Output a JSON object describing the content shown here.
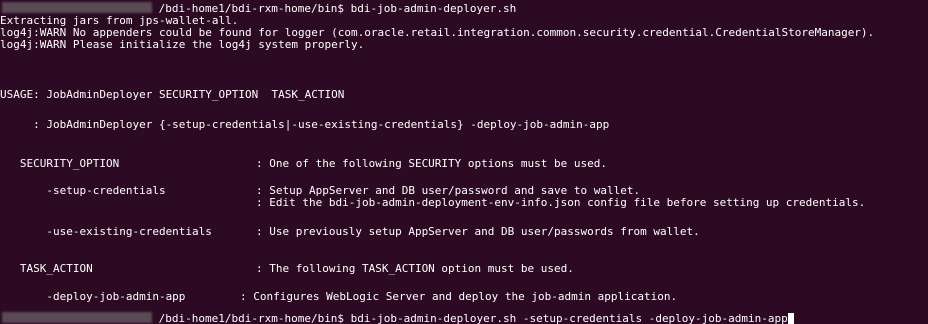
{
  "terminal": {
    "prompt1_suffix": "/bdi-home1/bdi-rxm-home/bin$ bdi-job-admin-deployer.sh",
    "out_extracting": "Extracting jars from jps-wallet-all.",
    "out_warn1": "log4j:WARN No appenders could be found for logger (com.oracle.retail.integration.common.security.credential.CredentialStoreManager).",
    "out_warn2": "log4j:WARN Please initialize the log4j system properly.",
    "usage_line": "USAGE: JobAdminDeployer SECURITY_OPTION  TASK_ACTION",
    "usage_alt": "     : JobAdminDeployer {-setup-credentials|-use-existing-credentials} -deploy-job-admin-app",
    "sec_option_label": "   SECURITY_OPTION",
    "sec_option_desc": ": One of the following SECURITY options must be used.",
    "setup_cred_label": "       -setup-credentials",
    "setup_cred_desc1": ": Setup AppServer and DB user/password and save to wallet.",
    "setup_cred_desc2": ": Edit the bdi-job-admin-deployment-env-info.json config file before setting up credentials.",
    "use_existing_label": "       -use-existing-credentials",
    "use_existing_desc": ": Use previously setup AppServer and DB user/passwords from wallet.",
    "task_action_label": "   TASK_ACTION",
    "task_action_desc": ": The following TASK_ACTION option must be used.",
    "deploy_label": "       -deploy-job-admin-app",
    "deploy_desc": ": Configures WebLogic Server and deploy the job-admin application.",
    "prompt2_suffix": "/bdi-home1/bdi-rxm-home/bin$ bdi-job-admin-deployer.sh -setup-credentials -deploy-job-admin-app"
  }
}
